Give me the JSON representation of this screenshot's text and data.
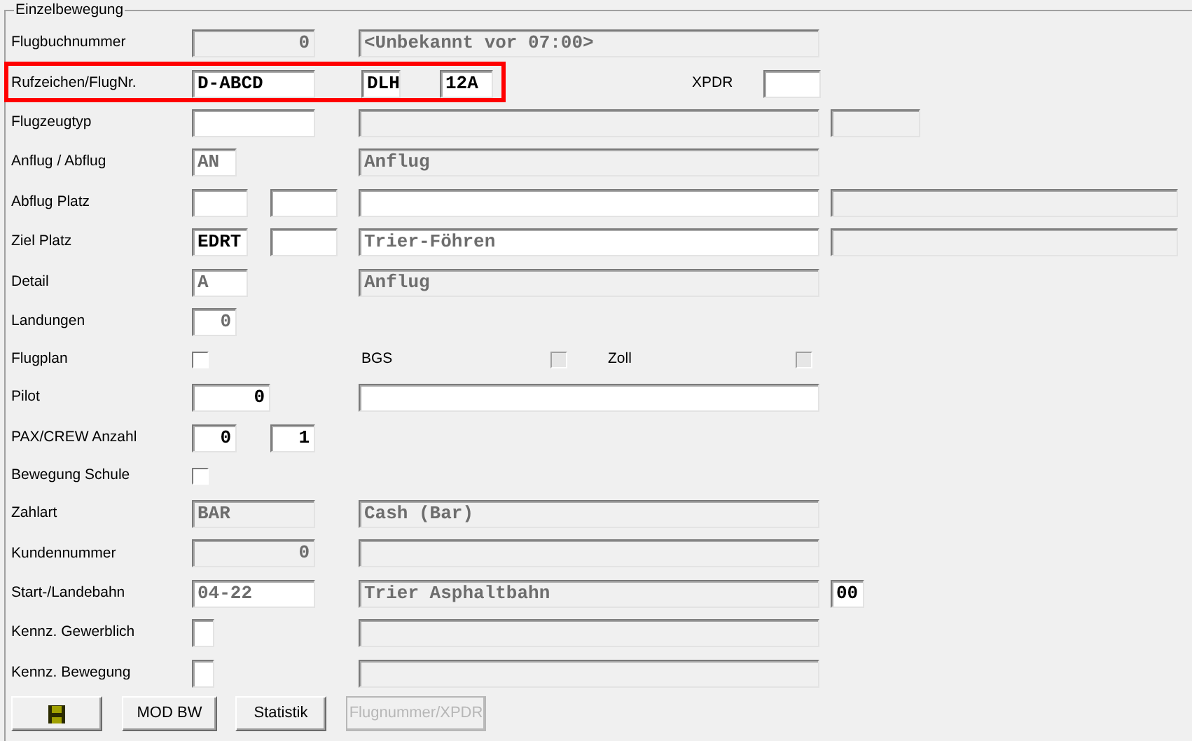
{
  "group_title": "Einzelbewegung",
  "rows": [
    {
      "label": "Flugbuchnummer",
      "highlighted": false,
      "items": [
        {
          "kind": "widefield",
          "value": "0",
          "numeric": true,
          "disabled": true
        },
        {
          "kind": "description",
          "value": "<Unbekannt vor 07:00>",
          "numeric": false,
          "disabled": true
        }
      ]
    },
    {
      "label": "Rufzeichen/FlugNr.",
      "highlighted": true,
      "items": [
        {
          "kind": "widefield",
          "value": "D-ABCD",
          "numeric": false,
          "disabled": false,
          "readonly": false
        },
        {
          "kind": "airline",
          "value": "DLH",
          "disabled": false,
          "readonly": false
        },
        {
          "kind": "flightno",
          "value": "12A",
          "numeric": false,
          "disabled": false,
          "readonly": false
        },
        {
          "kind": "xpdrcaption",
          "value": "XPDR"
        },
        {
          "kind": "xpdrfield",
          "disabled": false
        }
      ]
    },
    {
      "label": "Flugzeugtyp",
      "highlighted": false,
      "items": [
        {
          "kind": "widefield",
          "disabled": false
        },
        {
          "kind": "description",
          "disabled": true
        },
        {
          "kind": "extrashort",
          "disabled": true
        }
      ]
    },
    {
      "label": "Anflug / Abflug",
      "highlighted": false,
      "items": [
        {
          "kind": "smallfield",
          "value": "AN",
          "numeric": false,
          "disabled": false,
          "readonly": true
        },
        {
          "kind": "description",
          "value": "Anflug",
          "numeric": false,
          "disabled": true
        }
      ]
    },
    {
      "label": "Abflug Platz",
      "highlighted": false,
      "items": [
        {
          "kind": "midfield",
          "disabled": false
        },
        {
          "kind": "midfield2",
          "disabled": false
        },
        {
          "kind": "description",
          "disabled": false
        },
        {
          "kind": "extra",
          "disabled": true
        }
      ]
    },
    {
      "label": "Ziel Platz",
      "highlighted": false,
      "items": [
        {
          "kind": "midfield",
          "value": "EDRT",
          "numeric": false,
          "disabled": false,
          "readonly": false
        },
        {
          "kind": "midfield2",
          "disabled": false
        },
        {
          "kind": "description",
          "value": "Trier-Föhren",
          "numeric": false,
          "disabled": false,
          "readonly": true
        },
        {
          "kind": "extra",
          "disabled": true
        }
      ]
    },
    {
      "label": "Detail",
      "highlighted": false,
      "items": [
        {
          "kind": "midfield",
          "value": "A",
          "numeric": false,
          "disabled": false,
          "readonly": true
        },
        {
          "kind": "description",
          "value": "Anflug",
          "numeric": false,
          "disabled": true
        }
      ]
    },
    {
      "label": "Landungen",
      "highlighted": false,
      "items": [
        {
          "kind": "smallfield",
          "value": "0",
          "numeric": true,
          "disabled": false,
          "readonly": true
        }
      ]
    },
    {
      "label": "Flugplan",
      "highlighted": false,
      "items": [
        {
          "kind": "check",
          "checked": false,
          "disabled": false
        },
        {
          "kind": "bgscaption",
          "value": "BGS"
        },
        {
          "kind": "bgscheck",
          "checked": false,
          "disabled": true
        },
        {
          "kind": "zollcaption",
          "value": "Zoll"
        },
        {
          "kind": "zollcheck",
          "checked": false,
          "disabled": true
        }
      ]
    },
    {
      "label": "Pilot",
      "highlighted": false,
      "items": [
        {
          "kind": "pilotfield",
          "value": "0",
          "numeric": true,
          "disabled": false,
          "readonly": false
        },
        {
          "kind": "description",
          "disabled": false
        }
      ]
    },
    {
      "label": "PAX/CREW Anzahl",
      "highlighted": false,
      "items": [
        {
          "kind": "smallfield",
          "value": "0",
          "numeric": true,
          "disabled": false,
          "readonly": false
        },
        {
          "kind": "smallfield2",
          "value": "1",
          "numeric": true,
          "disabled": false,
          "readonly": false
        }
      ]
    },
    {
      "label": "Bewegung Schule",
      "highlighted": false,
      "items": [
        {
          "kind": "check",
          "checked": false,
          "disabled": false
        }
      ]
    },
    {
      "label": "Zahlart",
      "highlighted": false,
      "items": [
        {
          "kind": "widefield",
          "value": "BAR",
          "numeric": false,
          "disabled": true
        },
        {
          "kind": "description",
          "value": "Cash (Bar)",
          "numeric": false,
          "disabled": true
        }
      ]
    },
    {
      "label": "Kundennummer",
      "highlighted": false,
      "items": [
        {
          "kind": "widefield",
          "value": "0",
          "numeric": true,
          "disabled": true
        },
        {
          "kind": "description",
          "disabled": true
        }
      ]
    },
    {
      "label": "Start-/Landebahn",
      "highlighted": false,
      "items": [
        {
          "kind": "widefield",
          "value": "04-22",
          "numeric": false,
          "disabled": false,
          "readonly": true
        },
        {
          "kind": "description",
          "value": "Trier Asphaltbahn",
          "numeric": false,
          "disabled": true
        },
        {
          "kind": "suffix",
          "value": "00",
          "disabled": false,
          "readonly": false
        }
      ]
    },
    {
      "label": "Kennz. Gewerblich",
      "highlighted": false,
      "items": [
        {
          "kind": "boxfield",
          "disabled": false
        },
        {
          "kind": "description",
          "disabled": true
        }
      ]
    },
    {
      "label": "Kennz. Bewegung",
      "highlighted": false,
      "items": [
        {
          "kind": "boxfield",
          "disabled": false
        },
        {
          "kind": "description",
          "disabled": true
        }
      ]
    }
  ],
  "buttons": [
    {
      "kind": "save",
      "disabled": false
    },
    {
      "kind": "text",
      "label": "MOD BW",
      "disabled": false
    },
    {
      "kind": "text",
      "label": "Statistik",
      "disabled": false
    },
    {
      "kind": "text",
      "label": "Flugnummer/XPDR",
      "disabled": true
    }
  ]
}
